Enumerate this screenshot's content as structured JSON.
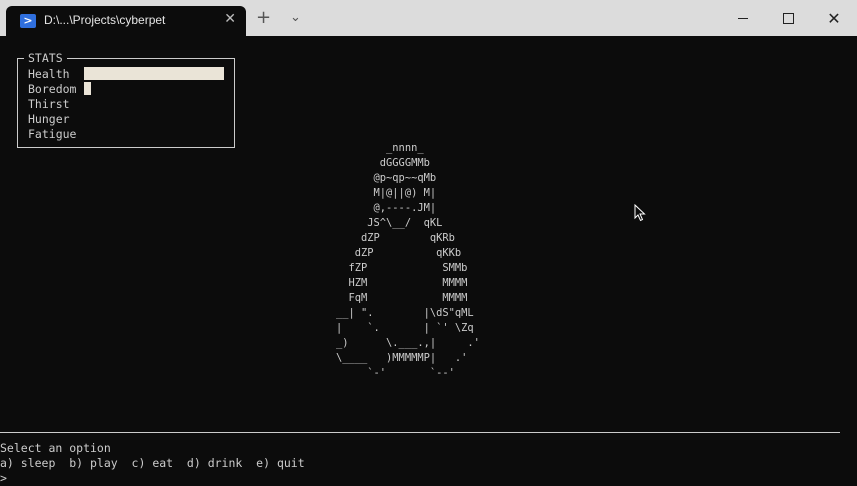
{
  "window": {
    "tab_title": "D:\\...\\Projects\\cyberpet",
    "tab_icon_glyph": ">",
    "tab_close_glyph": "✕",
    "new_tab_glyph": "+",
    "dropdown_glyph": "⌄",
    "close_glyph": "✕"
  },
  "stats": {
    "title": "STATS",
    "rows": [
      {
        "label": "Health",
        "level": 1.0
      },
      {
        "label": "Boredom",
        "level": 0.05
      },
      {
        "label": "Thirst",
        "level": 0
      },
      {
        "label": "Hunger",
        "level": 0
      },
      {
        "label": "Fatigue",
        "level": 0
      }
    ]
  },
  "pet_ascii": "        _nnnn_\n       dGGGGMMb\n      @p~qp~~qMb\n      M|@||@) M|\n      @,----.JM|\n     JS^\\__/  qKL\n    dZP        qKRb\n   dZP          qKKb\n  fZP            SMMb\n  HZM            MMMM\n  FqM            MMMM\n__| \".        |\\dS\"qML\n|    `.       | `' \\Zq\n_)      \\.___.,|     .'\n\\____   )MMMMMP|   .'\n     `-'       `--'",
  "footer": {
    "prompt_label": "Select an option",
    "options": "a) sleep  b) play  c) eat  d) drink  e) quit",
    "input_prompt": ">"
  }
}
